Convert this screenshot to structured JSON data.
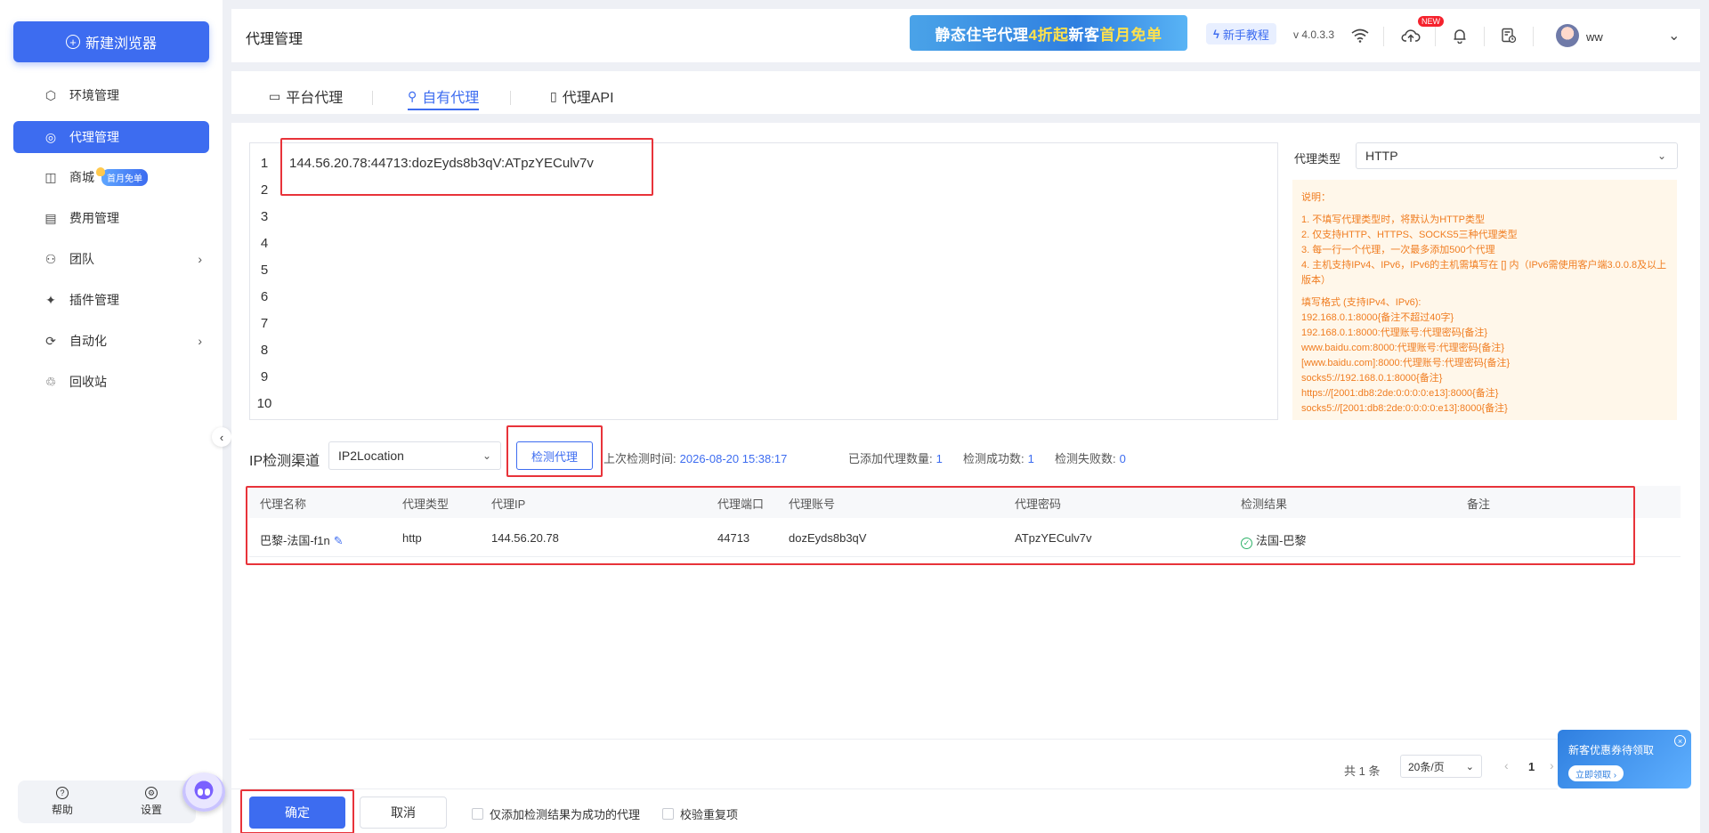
{
  "sidebar": {
    "new_browser_label": "新建浏览器",
    "items": [
      {
        "label": "环境管理",
        "icon": "cube-icon"
      },
      {
        "label": "代理管理",
        "icon": "globe-icon",
        "active": true
      },
      {
        "label": "商城",
        "icon": "shopping-bag-icon",
        "badge": "首月免单"
      },
      {
        "label": "费用管理",
        "icon": "billing-icon"
      },
      {
        "label": "团队",
        "icon": "team-icon",
        "has_children": true
      },
      {
        "label": "插件管理",
        "icon": "plugin-icon"
      },
      {
        "label": "自动化",
        "icon": "automation-icon",
        "has_children": true
      },
      {
        "label": "回收站",
        "icon": "recycle-icon"
      }
    ],
    "help_label": "帮助",
    "settings_label": "设置"
  },
  "header": {
    "title": "代理管理",
    "promo": {
      "part1": "静态住宅代理",
      "highlight": "4折起",
      "part2": " 新客",
      "highlight2": "首月免单"
    },
    "tutorial_label": "新手教程",
    "version": "v 4.0.3.3",
    "new_tag": "NEW",
    "username": "ww"
  },
  "tabs": [
    {
      "label": "平台代理",
      "icon": "monitor-icon"
    },
    {
      "label": "自有代理",
      "icon": "user-proxy-icon",
      "active": true
    },
    {
      "label": "代理API",
      "icon": "api-doc-icon"
    }
  ],
  "editor": {
    "line_numbers": [
      "1",
      "2",
      "3",
      "4",
      "5",
      "6",
      "7",
      "8",
      "9",
      "10"
    ],
    "line1": "144.56.20.78:44713:dozEyds8b3qV:ATpzYECulv7v"
  },
  "proxy_type": {
    "label": "代理类型",
    "value": "HTTP"
  },
  "notes": {
    "title": "说明：",
    "rules": [
      "1. 不填写代理类型时，将默认为HTTP类型",
      "2. 仅支持HTTP、HTTPS、SOCKS5三种代理类型",
      "3. 每一行一个代理，一次最多添加500个代理",
      "4. 主机支持IPv4、IPv6，IPv6的主机需填写在 [] 内（IPv6需使用客户端3.0.0.8及以上版本）"
    ],
    "format_title": "填写格式 (支持IPv4、IPv6):",
    "examples": [
      "192.168.0.1:8000{备注不超过40字}",
      "192.168.0.1:8000:代理账号:代理密码{备注}",
      "www.baidu.com:8000:代理账号:代理密码{备注}",
      "[www.baidu.com]:8000:代理账号:代理密码{备注}",
      "socks5://192.168.0.1:8000{备注}",
      "https://[2001:db8:2de:0:0:0:0:e13]:8000{备注}",
      "socks5://[2001:db8:2de:0:0:0:0:e13]:8000{备注}"
    ]
  },
  "detection": {
    "channel_label": "IP检测渠道",
    "channel_value": "IP2Location",
    "check_button": "检测代理",
    "last_check_label": "上次检测时间:",
    "last_check_value": "2026-08-20 15:38:17",
    "added_label": "已添加代理数量:",
    "added_value": "1",
    "success_label": "检测成功数:",
    "success_value": "1",
    "fail_label": "检测失败数:",
    "fail_value": "0"
  },
  "table": {
    "headers": [
      "代理名称",
      "代理类型",
      "代理IP",
      "代理端口",
      "代理账号",
      "代理密码",
      "检测结果",
      "备注"
    ],
    "rows": [
      {
        "name": "巴黎-法国-f1n",
        "type": "http",
        "ip": "144.56.20.78",
        "port": "44713",
        "account": "dozEyds8b3qV",
        "password": "ATpzYECulv7v",
        "result": "法国-巴黎",
        "remark": ""
      }
    ]
  },
  "pagination": {
    "total": "共 1 条",
    "page_size": "20条/页",
    "current": "1"
  },
  "coupon": {
    "title": "新客优惠券待领取",
    "button": "立即领取 ›"
  },
  "footer": {
    "confirm": "确定",
    "cancel": "取消",
    "only_success_label": "仅添加检测结果为成功的代理",
    "dedupe_label": "校验重复项"
  },
  "colors": {
    "primary": "#3d6cf0",
    "highlight_box": "#e8333a",
    "notes_text": "#f07d21",
    "notes_bg": "#fff7ea",
    "success": "#2fb36a"
  }
}
